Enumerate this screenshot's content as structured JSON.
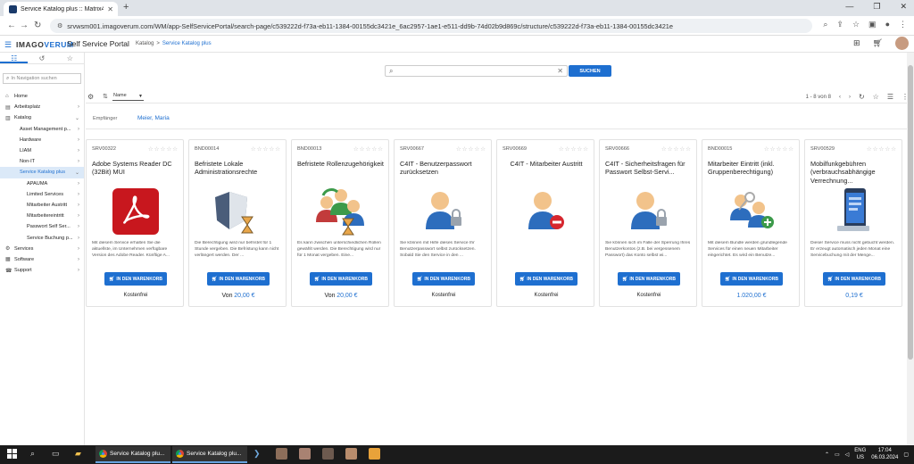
{
  "browser": {
    "tab_title": "Service Katalog plus :: Matrix42",
    "new_tab": "+",
    "url": "srvwsm001.imagoverum.com/WM/app-SelfServicePortal/search-page/c539222d-f73a-eb11-1384-00155dc3421e_6ac2957-1ae1-e511-dd9b-74d02b9d869c/structure/c539222d-f73a-eb11-1384-00155dc3421e"
  },
  "header": {
    "logo_left": "IMAGO",
    "logo_right": "VERUM",
    "portal_title": "Self Service Portal",
    "breadcrumb": [
      "Katalog",
      ">",
      "Service Katalog plus"
    ]
  },
  "sidebar": {
    "search_placeholder": "In Navigation suchen",
    "items": [
      {
        "label": "Home",
        "level": 1,
        "icon": "home-icon",
        "arrow": ""
      },
      {
        "label": "Arbeitsplatz",
        "level": 1,
        "icon": "workplace-icon",
        "arrow": "›"
      },
      {
        "label": "Katalog",
        "level": 1,
        "icon": "catalog-icon",
        "arrow": "⌄"
      },
      {
        "label": "Asset Management p...",
        "level": 2,
        "arrow": "›"
      },
      {
        "label": "Hardware",
        "level": 2,
        "arrow": "›"
      },
      {
        "label": "LIAM",
        "level": 2,
        "arrow": "›"
      },
      {
        "label": "Non-IT",
        "level": 2,
        "arrow": "›"
      },
      {
        "label": "Service Katalog plus",
        "level": 2,
        "arrow": "⌄",
        "selected": true
      },
      {
        "label": "APAUMA",
        "level": 3,
        "arrow": "›"
      },
      {
        "label": "Limited Services",
        "level": 3,
        "arrow": "›"
      },
      {
        "label": "Mitarbeiter Austritt",
        "level": 3,
        "arrow": "›"
      },
      {
        "label": "Mitarbeitereintritt",
        "level": 3,
        "arrow": "›"
      },
      {
        "label": "Passwort Self Ser...",
        "level": 3,
        "arrow": "›"
      },
      {
        "label": "Service Buchung p...",
        "level": 3,
        "arrow": "›"
      },
      {
        "label": "Services",
        "level": 1,
        "icon": "services-icon",
        "arrow": "›"
      },
      {
        "label": "Software",
        "level": 1,
        "icon": "software-icon",
        "arrow": "›"
      },
      {
        "label": "Support",
        "level": 1,
        "icon": "support-icon",
        "arrow": "›"
      }
    ]
  },
  "search": {
    "button": "SUCHEN"
  },
  "toolbar": {
    "sort_label": "Name",
    "paging": "1 - 8 von 8"
  },
  "recipient": {
    "label": "Empfänger",
    "value": "Meier, Maria"
  },
  "cart_label": "IN DEN WARENKORB",
  "cards": [
    {
      "id": "SRV00322",
      "title": "Adobe Systems Reader DC (32Bit) MUI",
      "image": "adobe-reader",
      "desc": "Mit diesem Service erhalten Sie die aktuellste, im Unternehmen verfügbare Version des Adobe Reader. Künftige A...",
      "price_prefix": "",
      "price": "Kostenfrei",
      "price_style": "plain"
    },
    {
      "id": "BND00014",
      "title": "Befristete Lokale Administrationsrechte",
      "image": "shield-hourglass",
      "desc": "Die Berechtigung wird nur befristet für 1 Stunde vergeben. Die Befristung kann nicht verlängert werden. Der ...",
      "price_prefix": "Von",
      "price": "20,00 €",
      "price_style": "blue"
    },
    {
      "id": "BND00013",
      "title": "Befristete Rollenzugehörigkeit",
      "image": "users-hourglass",
      "desc": "Es kann zwischen unterschiedlichen Rollen gewählt werden. Die Berechtigung wird nur für 1 Monat vergeben. Eine...",
      "price_prefix": "Von",
      "price": "20,00 €",
      "price_style": "blue"
    },
    {
      "id": "SRV00667",
      "title": "C4IT - Benutzerpasswort zurücksetzen",
      "image": "user-lock",
      "desc": "Sie können mit Hilfe dieses Service Ihr Benutzerpasswort selbst zurücksetzen. Sobald Sie den Service in den ...",
      "price_prefix": "",
      "price": "Kostenfrei",
      "price_style": "plain"
    },
    {
      "id": "SRV00669",
      "title": "C4IT - Mitarbeiter Austritt",
      "image": "user-remove",
      "desc": "",
      "price_prefix": "",
      "price": "Kostenfrei",
      "price_style": "plain",
      "center": true
    },
    {
      "id": "SRV00666",
      "title": "C4IT - Sicherheitsfragen für Passwort Selbst-Servi...",
      "image": "user-lock",
      "desc": "Sie können sich im Falle der Sperrung Ihres Benutzerkontos (z.B. bei vergessenem Passwort) das Konto selbst wi...",
      "price_prefix": "",
      "price": "Kostenfrei",
      "price_style": "plain"
    },
    {
      "id": "BND00015",
      "title": "Mitarbeiter Eintritt (inkl. Gruppenberechtigung)",
      "image": "users-add",
      "desc": "Mit diesem Bundle werden grundlegende Services für einen neuen Mitarbeiter eingerichtet. Es wird ein Benutze...",
      "price_prefix": "",
      "price": "1.020,00 €",
      "price_style": "blue"
    },
    {
      "id": "SRV00529",
      "title": "Mobilfunkgebühren (verbrauchsabhängige Verrechnung...",
      "image": "phone",
      "desc": "Dieser Service muss nicht gebucht werden. Er erzeugt automatisch jeden Monat eine Servicebuchung mit der Menge...",
      "price_prefix": "",
      "price": "0,19 €",
      "price_style": "blue"
    }
  ],
  "taskbar": {
    "app1": "Service Katalog plu...",
    "app2": "Service Katalog plu...",
    "lang1": "ENG",
    "lang2": "US",
    "time": "17:04",
    "date": "06.03.2024"
  },
  "colors": {
    "accent": "#1e6fd0",
    "adobe": "#c8171e"
  }
}
